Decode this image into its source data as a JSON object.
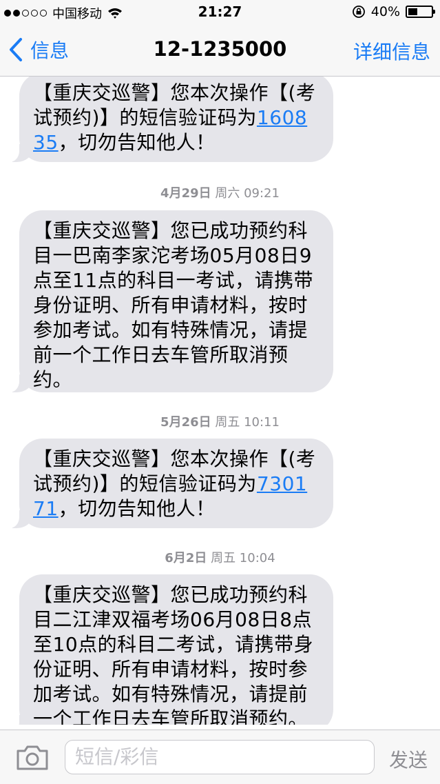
{
  "status_bar": {
    "carrier": "中国移动",
    "time": "21:27",
    "battery": "40%",
    "battery_level": 0.4
  },
  "nav": {
    "back_label": "信息",
    "title": "12-1235000",
    "details_label": "详细信息"
  },
  "messages": [
    {
      "pre": "【重庆交巡警】您本次操作【(考试预约)】的短信验证码为",
      "code": "160835",
      "post": "，切勿告知他人！"
    },
    {
      "timestamp_date": "4月29日",
      "timestamp_rest": " 周六 09:21",
      "text": "【重庆交巡警】您已成功预约科目一巴南李家沱考场05月08日9点至11点的科目一考试，请携带身份证明、所有申请材料，按时参加考试。如有特殊情况，请提前一个工作日去车管所取消预约。"
    },
    {
      "timestamp_date": "5月26日",
      "timestamp_rest": " 周五 10:11",
      "pre": "【重庆交巡警】您本次操作【(考试预约)】的短信验证码为",
      "code": "730171",
      "post": "，切勿告知他人！"
    },
    {
      "timestamp_date": "6月2日",
      "timestamp_rest": " 周五 10:04",
      "text": "【重庆交巡警】您已成功预约科目二江津双福考场06月08日8点至10点的科目二考试，请携带身份证明、所有申请材料，按时参加考试。如有特殊情况，请提前一个工作日去车管所取消预约。"
    }
  ],
  "input": {
    "placeholder": "短信/彩信",
    "send_label": "发送"
  },
  "colors": {
    "accent": "#1a7cf5",
    "bubble": "#e5e5ea",
    "timestamp": "#8e8e93"
  }
}
